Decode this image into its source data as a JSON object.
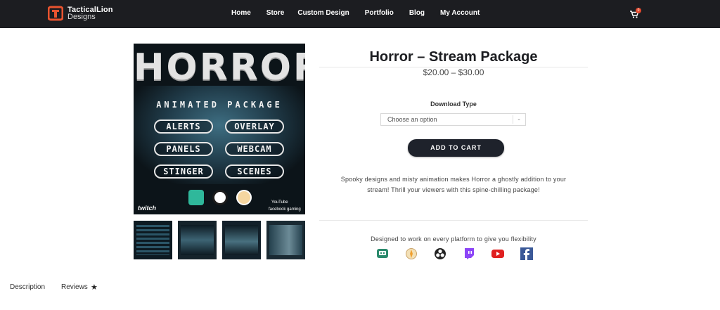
{
  "header": {
    "logo_line1": "TacticalLion",
    "logo_line2": "Designs",
    "nav": [
      "Home",
      "Store",
      "Custom Design",
      "Portfolio",
      "Blog",
      "My Account"
    ],
    "cart_count": "0",
    "cart_icon": "shopping-cart-icon"
  },
  "product": {
    "title": "Horror – Stream Package",
    "price": "$20.00 – $30.00",
    "download_label": "Download Type",
    "select_placeholder": "Choose an option",
    "add_to_cart": "ADD TO CART",
    "description_line1": "Spooky designs and misty animation makes Horror a ghostly addition to your",
    "description_line2": "stream! Thrill your viewers with this spine-chilling package!",
    "platforms_label": "Designed to work on every platform to give you flexibility",
    "platform_icons": [
      "streamlabs-icon",
      "xsplit-icon",
      "obs-icon",
      "twitch-icon",
      "youtube-icon",
      "facebook-icon"
    ]
  },
  "artwork": {
    "title": "HORROR",
    "subtitle": "ANIMATED PACKAGE",
    "pills": [
      "ALERTS",
      "OVERLAY",
      "PANELS",
      "WEBCAM",
      "STINGER",
      "SCENES"
    ],
    "twitch": "twitch",
    "youtube": "YouTube",
    "facebook": "facebook gaming"
  },
  "tabs": {
    "description": "Description",
    "reviews": "Reviews"
  },
  "colors": {
    "header_bg": "#1c1d21",
    "button_bg": "#1e222b",
    "badge": "#e64a2e"
  }
}
